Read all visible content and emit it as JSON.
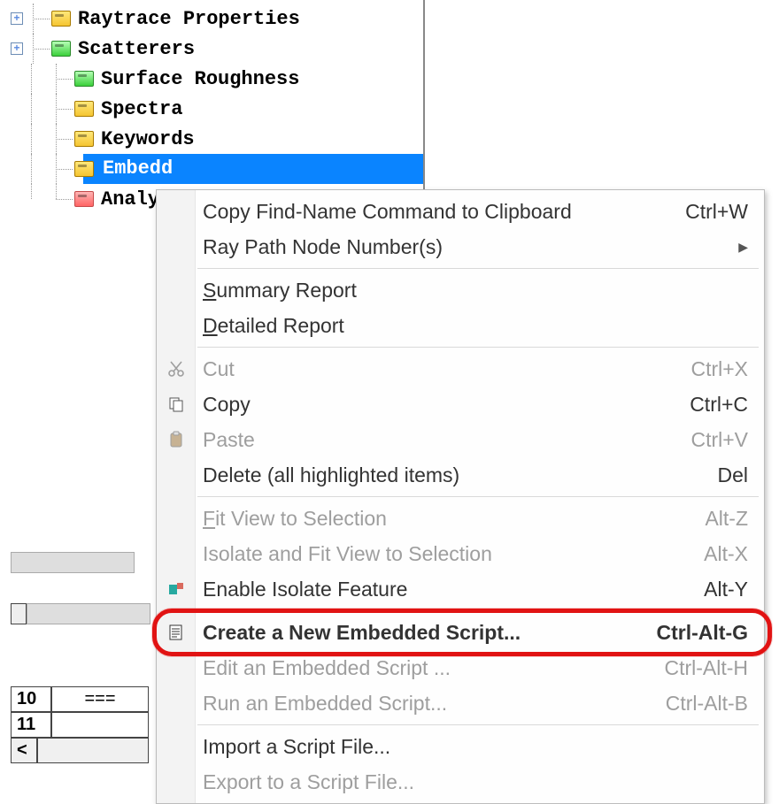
{
  "tree": {
    "items": [
      {
        "label": "Raytrace Properties",
        "expand": "+",
        "icon": "folder-yellow"
      },
      {
        "label": "Scatterers",
        "expand": "+",
        "icon": "folder-green"
      },
      {
        "label": "Surface Roughness",
        "expand": "",
        "icon": "folder-green"
      },
      {
        "label": "Spectra",
        "expand": "",
        "icon": "folder-yellow"
      },
      {
        "label": "Keywords",
        "expand": "",
        "icon": "folder-yellow"
      },
      {
        "label": "Embedd",
        "expand": "",
        "icon": "folder-yellow",
        "selected": true
      },
      {
        "label": "Analys",
        "expand": "",
        "icon": "folder-red"
      }
    ]
  },
  "grid": {
    "row1_num": "10",
    "row1_val": "===",
    "row2_num": "11",
    "scroll_left": "<"
  },
  "menu": {
    "copy_find": {
      "label": "Copy Find-Name Command to Clipboard",
      "shortcut": "Ctrl+W"
    },
    "ray_path": {
      "label": "Ray Path Node Number(s)"
    },
    "summary": {
      "pre": "",
      "u": "S",
      "post": "ummary Report"
    },
    "detailed": {
      "pre": "",
      "u": "D",
      "post": "etailed Report"
    },
    "cut": {
      "label": "Cut",
      "shortcut": "Ctrl+X"
    },
    "copy": {
      "label": "Copy",
      "shortcut": "Ctrl+C"
    },
    "paste": {
      "label": "Paste",
      "shortcut": "Ctrl+V"
    },
    "delete": {
      "label": "Delete (all highlighted items)",
      "shortcut": "Del"
    },
    "fit": {
      "pre": "",
      "u": "F",
      "post": "it View to Selection",
      "shortcut": "Alt-Z"
    },
    "isolate": {
      "label": "Isolate and Fit View to Selection",
      "shortcut": "Alt-X"
    },
    "enable_iso": {
      "label": "Enable Isolate Feature",
      "shortcut": "Alt-Y"
    },
    "create": {
      "label": "Create a New Embedded Script...",
      "shortcut": "Ctrl-Alt-G"
    },
    "edit": {
      "label": "Edit an Embedded Script ...",
      "shortcut": "Ctrl-Alt-H"
    },
    "run": {
      "label": "Run an Embedded Script...",
      "shortcut": "Ctrl-Alt-B"
    },
    "import": {
      "label": "Import a Script File..."
    },
    "export": {
      "label": "Export to a Script File..."
    }
  }
}
